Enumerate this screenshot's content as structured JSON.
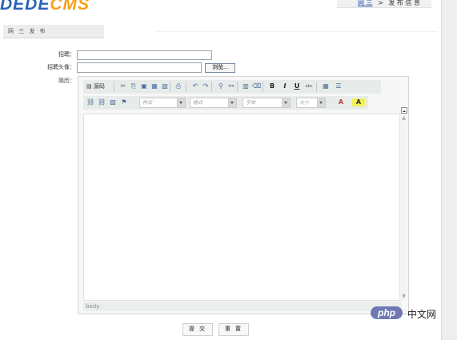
{
  "header": {
    "logo_part1": "DEDE",
    "logo_part2": "CMS",
    "breadcrumb_link": "网 三",
    "breadcrumb_sep": ">",
    "breadcrumb_current": "发 布 信 息"
  },
  "tab": {
    "label": "网 三 发 布",
    "icon": "grid-icon"
  },
  "form": {
    "field1_label": "招聘：",
    "field1_value": "",
    "field2_label": "招聘头像：",
    "field2_value": "",
    "browse_label": "浏览...",
    "field3_label": "简历："
  },
  "editor": {
    "toolbar1": [
      {
        "name": "source-icon",
        "glyph": "▤",
        "label": "源码"
      },
      {
        "name": "cut-icon",
        "glyph": "✂"
      },
      {
        "name": "copy-icon",
        "glyph": "⎘"
      },
      {
        "name": "paste-icon",
        "glyph": "▣"
      },
      {
        "name": "paste-text-icon",
        "glyph": "▦"
      },
      {
        "name": "paste-word-icon",
        "glyph": "▧"
      },
      {
        "name": "print-icon",
        "glyph": "⎙"
      },
      {
        "name": "undo-icon",
        "glyph": "↶"
      },
      {
        "name": "redo-icon",
        "glyph": "↷"
      },
      {
        "name": "find-icon",
        "glyph": "⚲"
      },
      {
        "name": "replace-icon",
        "glyph": "⚯"
      },
      {
        "name": "select-all-icon",
        "glyph": "▥"
      },
      {
        "name": "remove-format-icon",
        "glyph": "⌫"
      },
      {
        "name": "bold-icon",
        "glyph": "B"
      },
      {
        "name": "italic-icon",
        "glyph": "I"
      },
      {
        "name": "underline-icon",
        "glyph": "U"
      },
      {
        "name": "strike-icon",
        "glyph": "abc"
      },
      {
        "name": "table-icon",
        "glyph": "▦"
      },
      {
        "name": "horizontal-rule-icon",
        "glyph": "☰"
      }
    ],
    "toolbar2_icons": [
      {
        "name": "link-icon",
        "glyph": "⛓"
      },
      {
        "name": "unlink-icon",
        "glyph": "⛓"
      },
      {
        "name": "image-icon",
        "glyph": "▨"
      },
      {
        "name": "flag-icon",
        "glyph": "⚑"
      }
    ],
    "style_placeholder": "样式",
    "format_placeholder": "格式",
    "font_placeholder": "字体",
    "size_placeholder": "大小",
    "text_color_icon": "text-color-icon",
    "bg_color_icon": "bg-color-icon",
    "text_color_glyph": "A",
    "bg_color_glyph": "A",
    "status": "body"
  },
  "buttons": {
    "submit": "提 交",
    "reset": "重 置"
  },
  "watermark": {
    "pill": "php",
    "text": "中文网"
  },
  "colors": {
    "logo_blue": "#2a63b8",
    "logo_orange": "#f5a11a",
    "watermark": "#6e79b4"
  }
}
